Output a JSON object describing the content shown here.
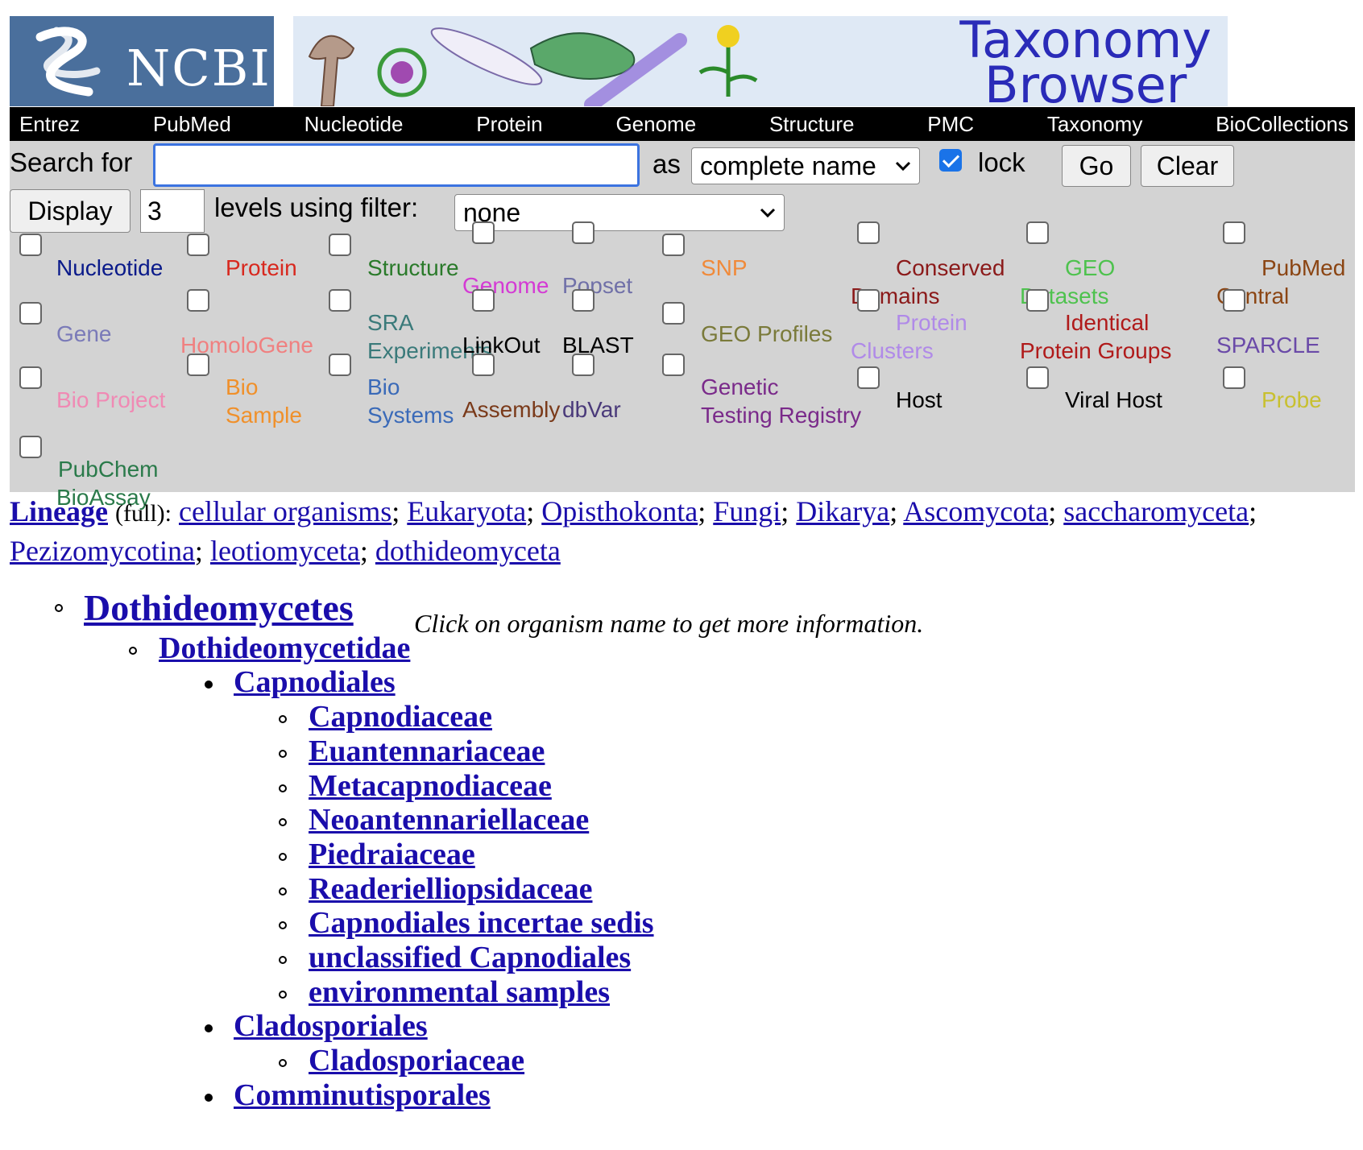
{
  "banner": {
    "ncbi_label": "NCBI",
    "title_line1": "Taxonomy",
    "title_line2": "Browser"
  },
  "nav": [
    "Entrez",
    "PubMed",
    "Nucleotide",
    "Protein",
    "Genome",
    "Structure",
    "PMC",
    "Taxonomy",
    "BioCollections"
  ],
  "search": {
    "label": "Search for",
    "value": "",
    "as_label": "as",
    "mode": "complete name",
    "lock_label": "lock",
    "lock_checked": true,
    "go_label": "Go",
    "clear_label": "Clear"
  },
  "display": {
    "button": "Display",
    "levels": "3",
    "levels_label": "levels using filter:",
    "filter": "none"
  },
  "databases": [
    {
      "label": "Nucleotide",
      "color": "#0a1a8a"
    },
    {
      "label": "Protein",
      "color": "#d8281e"
    },
    {
      "label": "Structure",
      "color": "#2a7a2a"
    },
    {
      "label": "Genome",
      "color": "#d43ad4"
    },
    {
      "label": "Popset",
      "color": "#7070a8"
    },
    {
      "label": "SNP",
      "color": "#f08a3a"
    },
    {
      "label": "Conserved Domains",
      "color": "#8b1a1a"
    },
    {
      "label": "GEO Datasets",
      "color": "#4ec24e"
    },
    {
      "label": "PubMed Central",
      "color": "#8b4513"
    },
    {
      "label": "Gene",
      "color": "#7a7ab8"
    },
    {
      "label": "HomoloGene",
      "color": "#f08080"
    },
    {
      "label": "SRA Experiments",
      "color": "#3a7a7a"
    },
    {
      "label": "LinkOut",
      "color": "#000000"
    },
    {
      "label": "BLAST",
      "color": "#000000"
    },
    {
      "label": "GEO Profiles",
      "color": "#7a7a3a"
    },
    {
      "label": "Protein Clusters",
      "color": "#b08ae8"
    },
    {
      "label": "Identical Protein Groups",
      "color": "#b01a1a"
    },
    {
      "label": "SPARCLE",
      "color": "#6a4aa8"
    },
    {
      "label": "Bio Project",
      "color": "#f08ab4"
    },
    {
      "label": "Bio Sample",
      "color": "#f0902a"
    },
    {
      "label": "Bio Systems",
      "color": "#3a6ab8"
    },
    {
      "label": "Assembly",
      "color": "#7a3a1a"
    },
    {
      "label": "dbVar",
      "color": "#4a3a7a"
    },
    {
      "label": "Genetic Testing Registry",
      "color": "#7a2a8a"
    },
    {
      "label": "Host",
      "color": "#000000"
    },
    {
      "label": "Viral Host",
      "color": "#000000"
    },
    {
      "label": "Probe",
      "color": "#c8c030"
    },
    {
      "label": "PubChem BioAssay",
      "color": "#2a7a4a"
    }
  ],
  "lineage": {
    "title": "Lineage",
    "full": "(full):",
    "items": [
      "cellular organisms",
      "Eukaryota",
      "Opisthokonta",
      "Fungi",
      "Dikarya",
      "Ascomycota",
      "saccharomyceta",
      "Pezizomycotina",
      "leotiomyceta",
      "dothideomyceta"
    ]
  },
  "tree": {
    "hint": "Click on organism name to get more information.",
    "nodes": [
      {
        "name": "Dothideomycetes",
        "level": 0
      },
      {
        "name": "Dothideomycetidae",
        "level": 1
      },
      {
        "name": "Capnodiales",
        "level": 2
      },
      {
        "name": "Capnodiaceae",
        "level": 3
      },
      {
        "name": "Euantennariaceae",
        "level": 3
      },
      {
        "name": "Metacapnodiaceae",
        "level": 3
      },
      {
        "name": "Neoantennariellaceae",
        "level": 3
      },
      {
        "name": "Piedraiaceae",
        "level": 3
      },
      {
        "name": "Readerielliopsidaceae",
        "level": 3
      },
      {
        "name": "Capnodiales incertae sedis",
        "level": 3
      },
      {
        "name": "unclassified Capnodiales",
        "level": 3
      },
      {
        "name": "environmental samples",
        "level": 3
      },
      {
        "name": "Cladosporiales",
        "level": 2
      },
      {
        "name": "Cladosporiaceae",
        "level": 3
      },
      {
        "name": "Comminutisporales",
        "level": 2
      }
    ]
  }
}
